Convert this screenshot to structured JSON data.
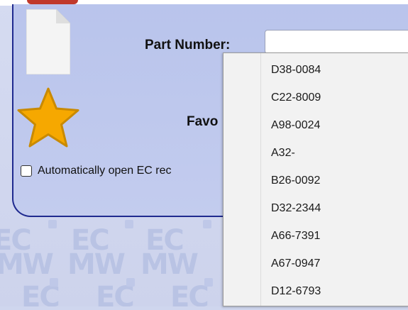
{
  "form": {
    "part_number_label": "Part Number:",
    "favorite_label_partial": "Favo",
    "auto_open_label": "Automatically open EC rec"
  },
  "watermark": {
    "text_ec": "EC",
    "text_mw": "MW"
  },
  "dropdown": {
    "items": [
      "D38-0084",
      "C22-8009",
      "A98-0024",
      "A32-",
      "B26-0092",
      "D32-2344",
      "A66-7391",
      "A67-0947",
      "D12-6793"
    ]
  },
  "icons": {
    "document": "document-icon",
    "favorite": "star-icon"
  },
  "colors": {
    "panel_border": "#1f2a8f",
    "star_fill": "#f6a800",
    "star_stroke": "#c98a00"
  }
}
